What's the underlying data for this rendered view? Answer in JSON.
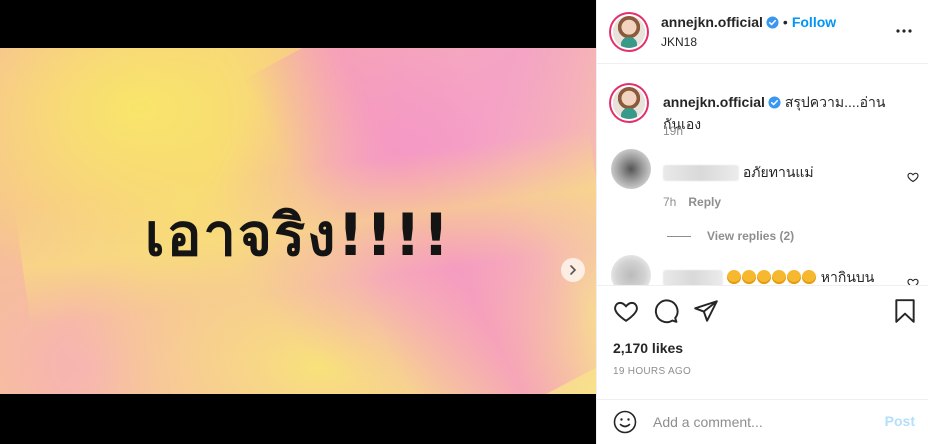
{
  "media": {
    "slide_text": "เอาจริง!!!!",
    "slide_count": 2,
    "active_slide": 1
  },
  "header": {
    "username": "annejkn.official",
    "separator": "•",
    "follow_label": "Follow",
    "location": "JKN18"
  },
  "caption": {
    "username": "annejkn.official",
    "text": "สรุปความ....อ่านกันเอง",
    "time": "19h"
  },
  "comments": [
    {
      "text": "อภัยทานแม่",
      "time": "7h",
      "reply_label": "Reply",
      "view_replies_label": "View replies (2)"
    },
    {
      "emoji_count": 6,
      "text": "หากินบน"
    }
  ],
  "engagement": {
    "likes": "2,170 likes",
    "timestamp": "19 HOURS AGO"
  },
  "add_comment": {
    "placeholder": "Add a comment...",
    "post_label": "Post"
  },
  "colors": {
    "accent": "#0095f6",
    "post_disabled": "#b2dffc",
    "verified": "#3897f0",
    "muted": "#8e8e8e"
  },
  "icons": {
    "next": "chevron-right-icon",
    "more": "more-horizontal-icon",
    "like": "heart-icon",
    "comment": "comment-icon",
    "share": "paper-plane-icon",
    "save": "bookmark-icon",
    "emoji": "smiley-icon"
  }
}
